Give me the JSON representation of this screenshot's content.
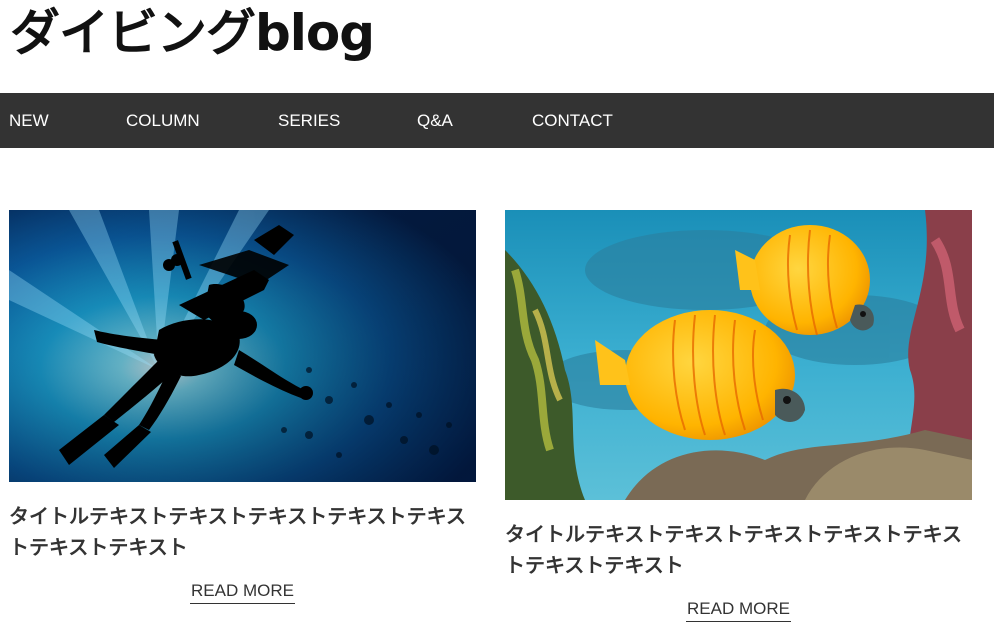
{
  "site": {
    "title": "ダイビングblog"
  },
  "nav": {
    "items": [
      {
        "label": "NEW"
      },
      {
        "label": "COLUMN"
      },
      {
        "label": "SERIES"
      },
      {
        "label": "Q&A"
      },
      {
        "label": "CONTACT"
      }
    ]
  },
  "posts": [
    {
      "title": "タイトルテキストテキストテキストテキストテキストテキストテキスト",
      "read_more": "READ MORE"
    },
    {
      "title": "タイトルテキストテキストテキストテキストテキストテキストテキスト",
      "read_more": "READ MORE"
    }
  ],
  "colors": {
    "nav_background": "#333333",
    "text": "#333333",
    "background": "#ffffff"
  }
}
